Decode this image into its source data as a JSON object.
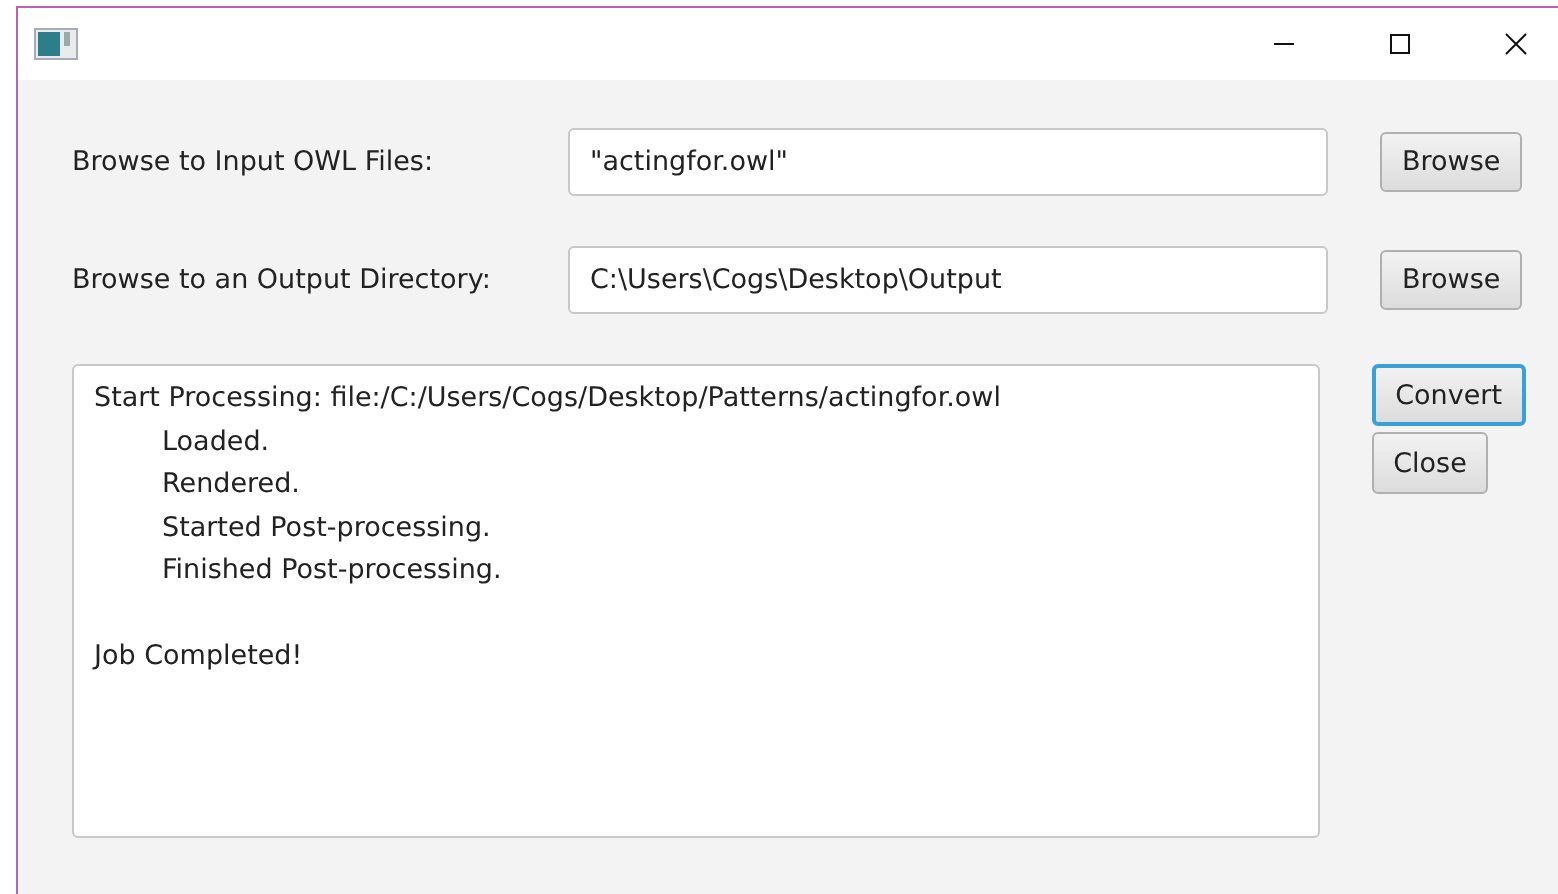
{
  "window": {
    "controls": [
      {
        "kind": "minimize"
      },
      {
        "kind": "maximize"
      },
      {
        "kind": "close"
      }
    ]
  },
  "rows": [
    {
      "label": "Browse to Input OWL Files:",
      "value": "\"actingfor.owl\"",
      "button": "Browse"
    },
    {
      "label": "Browse to an Output Directory:",
      "value": "C:\\Users\\Cogs\\Desktop\\Output",
      "button": "Browse"
    }
  ],
  "log": [
    {
      "text": "Start Processing: file:/C:/Users/Cogs/Desktop/Patterns/actingfor.owl",
      "children": [
        {
          "text": "Loaded."
        },
        {
          "text": "Rendered."
        },
        {
          "text": "Started Post-processing."
        },
        {
          "text": "Finished Post-processing."
        }
      ]
    },
    {
      "text": "Job Completed!"
    }
  ],
  "actions": [
    {
      "label": "Convert",
      "focused": true
    },
    {
      "label": "Close",
      "focused": false
    }
  ]
}
